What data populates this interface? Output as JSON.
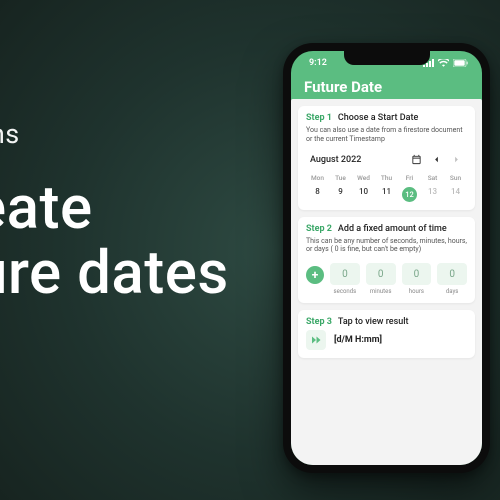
{
  "background": {
    "subtitle": "ons",
    "headline_line1": "eate",
    "headline_line2": "ure dates"
  },
  "colors": {
    "accent": "#5bbd81"
  },
  "statusbar": {
    "time": "9:12"
  },
  "appbar": {
    "title": "Future Date"
  },
  "step1": {
    "label": "Step 1",
    "title": "Choose a Start Date",
    "description": "You can also use a date from a firestore document or the current Timestamp"
  },
  "calendar": {
    "month_label": "August 2022",
    "dow": [
      "Mon",
      "Tue",
      "Wed",
      "Thu",
      "Fri",
      "Sat",
      "Sun"
    ],
    "days": [
      "8",
      "9",
      "10",
      "11",
      "12",
      "13",
      "14"
    ],
    "selected_index": 4
  },
  "step2": {
    "label": "Step 2",
    "title": "Add a fixed amount of time",
    "description": "This can be any number of seconds, minutes, hours, or days ( 0  is fine, but can't be empty)"
  },
  "time_units": [
    {
      "value": "0",
      "label": "seconds"
    },
    {
      "value": "0",
      "label": "minutes"
    },
    {
      "value": "0",
      "label": "hours"
    },
    {
      "value": "0",
      "label": "days"
    }
  ],
  "step3": {
    "label": "Step 3",
    "title": "Tap to view result",
    "format": "[d/M H:mm]"
  }
}
